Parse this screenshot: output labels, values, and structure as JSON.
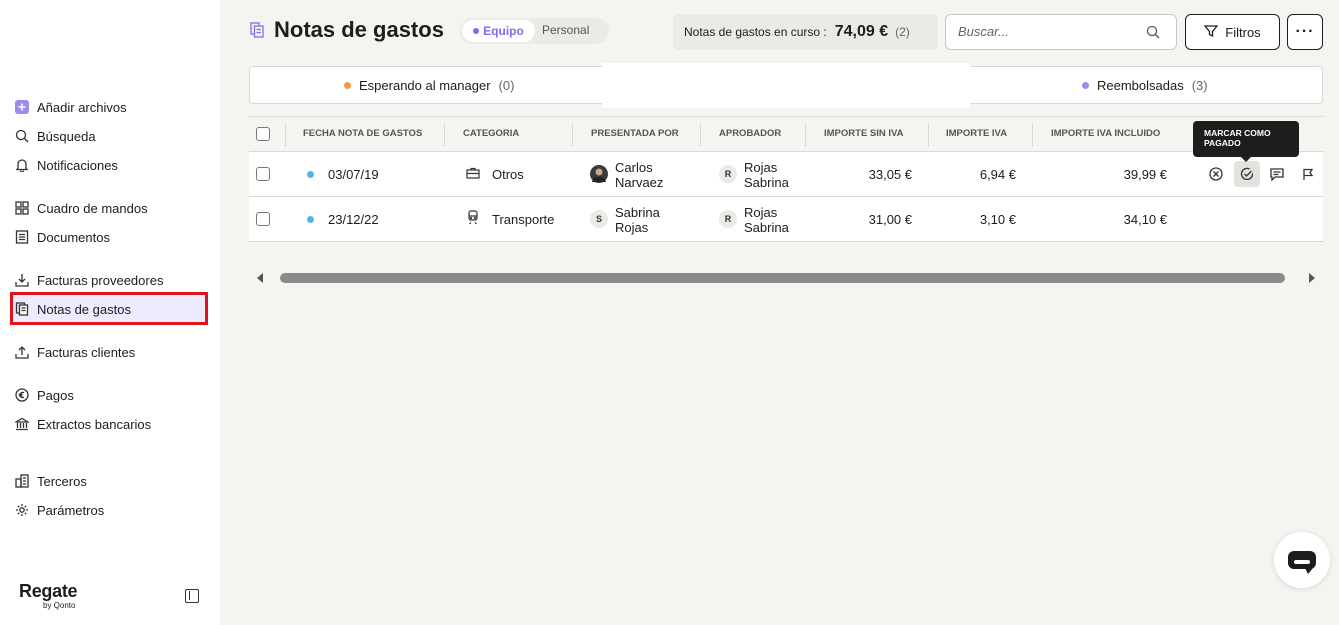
{
  "sidebar": {
    "items": [
      {
        "label": "Añadir archivos",
        "icon": "plus-square-icon"
      },
      {
        "label": "Búsqueda",
        "icon": "search-icon"
      },
      {
        "label": "Notificaciones",
        "icon": "bell-icon"
      },
      {
        "label": "Cuadro de mandos",
        "icon": "dashboard-grid-icon"
      },
      {
        "label": "Documentos",
        "icon": "document-icon"
      },
      {
        "label": "Facturas proveedores",
        "icon": "inbox-download-icon"
      },
      {
        "label": "Notas de gastos",
        "icon": "expense-notes-icon"
      },
      {
        "label": "Facturas clientes",
        "icon": "outbox-upload-icon"
      },
      {
        "label": "Pagos",
        "icon": "euro-circle-icon"
      },
      {
        "label": "Extractos bancarios",
        "icon": "bank-icon"
      },
      {
        "label": "Terceros",
        "icon": "buildings-icon"
      },
      {
        "label": "Parámetros",
        "icon": "gear-icon"
      }
    ],
    "active_item": "Notas de gastos",
    "brand": {
      "name": "Regate",
      "sub": "by Qonto"
    }
  },
  "header": {
    "title": "Notas de gastos",
    "toggle": {
      "options": [
        "Equipo",
        "Personal"
      ],
      "selected": "Equipo"
    },
    "summary": {
      "label": "Notas de gastos en curso :",
      "amount": "74,09 €",
      "count": "(2)"
    },
    "search": {
      "placeholder": "Buscar..."
    },
    "filters_label": "Filtros",
    "more_label": "···"
  },
  "status_tabs": [
    {
      "label": "Esperando al manager",
      "count": "(0)",
      "color": "#f2994a"
    },
    {
      "label": "Reembolsadas",
      "count": "(3)",
      "color": "#9b8cf0"
    }
  ],
  "table": {
    "columns": [
      "Fecha nota de gastos",
      "Categoria",
      "Presentada por",
      "Aprobador",
      "Importe sin IVA",
      "Importe IVA",
      "Importe IVA incluido"
    ],
    "rows": [
      {
        "date": "03/07/19",
        "category": "Otros",
        "category_icon": "briefcase-icon",
        "submitted_by": {
          "name_1": "Carlos",
          "name_2": "Narvaez",
          "avatar": "photo"
        },
        "approver": {
          "initial": "R",
          "name_1": "Rojas",
          "name_2": "Sabrina"
        },
        "amount_excl": "33,05 €",
        "vat": "6,94 €",
        "amount_incl": "39,99 €"
      },
      {
        "date": "23/12/22",
        "category": "Transporte",
        "category_icon": "train-icon",
        "submitted_by": {
          "name_1": "Sabrina",
          "name_2": "Rojas",
          "avatar": "S"
        },
        "approver": {
          "initial": "R",
          "name_1": "Rojas",
          "name_2": "Sabrina"
        },
        "amount_excl": "31,00 €",
        "vat": "3,10 €",
        "amount_incl": "34,10 €"
      }
    ],
    "row_actions": [
      "reject-icon",
      "mark-paid-icon",
      "comment-icon",
      "flag-icon"
    ],
    "tooltip": "Marcar como pagado"
  },
  "colors": {
    "accent": "#7c6cf0",
    "highlight_border": "#e0121a",
    "status_dot": "#4fb5f0"
  }
}
